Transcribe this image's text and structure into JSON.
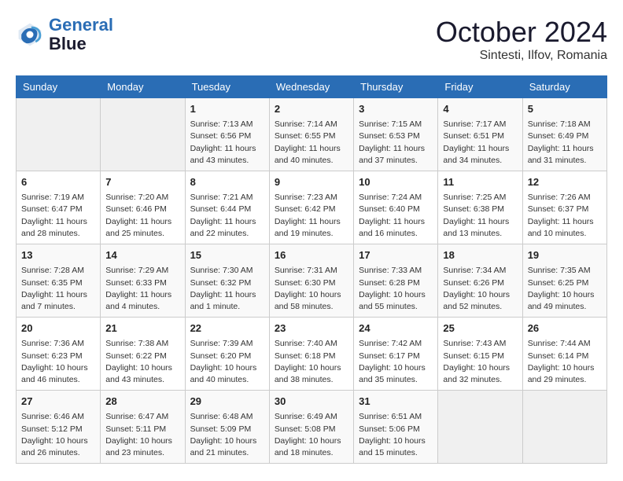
{
  "header": {
    "logo_line1": "General",
    "logo_line2": "Blue",
    "month": "October 2024",
    "location": "Sintesti, Ilfov, Romania"
  },
  "weekdays": [
    "Sunday",
    "Monday",
    "Tuesday",
    "Wednesday",
    "Thursday",
    "Friday",
    "Saturday"
  ],
  "weeks": [
    [
      {
        "day": "",
        "info": ""
      },
      {
        "day": "",
        "info": ""
      },
      {
        "day": "1",
        "info": "Sunrise: 7:13 AM\nSunset: 6:56 PM\nDaylight: 11 hours and 43 minutes."
      },
      {
        "day": "2",
        "info": "Sunrise: 7:14 AM\nSunset: 6:55 PM\nDaylight: 11 hours and 40 minutes."
      },
      {
        "day": "3",
        "info": "Sunrise: 7:15 AM\nSunset: 6:53 PM\nDaylight: 11 hours and 37 minutes."
      },
      {
        "day": "4",
        "info": "Sunrise: 7:17 AM\nSunset: 6:51 PM\nDaylight: 11 hours and 34 minutes."
      },
      {
        "day": "5",
        "info": "Sunrise: 7:18 AM\nSunset: 6:49 PM\nDaylight: 11 hours and 31 minutes."
      }
    ],
    [
      {
        "day": "6",
        "info": "Sunrise: 7:19 AM\nSunset: 6:47 PM\nDaylight: 11 hours and 28 minutes."
      },
      {
        "day": "7",
        "info": "Sunrise: 7:20 AM\nSunset: 6:46 PM\nDaylight: 11 hours and 25 minutes."
      },
      {
        "day": "8",
        "info": "Sunrise: 7:21 AM\nSunset: 6:44 PM\nDaylight: 11 hours and 22 minutes."
      },
      {
        "day": "9",
        "info": "Sunrise: 7:23 AM\nSunset: 6:42 PM\nDaylight: 11 hours and 19 minutes."
      },
      {
        "day": "10",
        "info": "Sunrise: 7:24 AM\nSunset: 6:40 PM\nDaylight: 11 hours and 16 minutes."
      },
      {
        "day": "11",
        "info": "Sunrise: 7:25 AM\nSunset: 6:38 PM\nDaylight: 11 hours and 13 minutes."
      },
      {
        "day": "12",
        "info": "Sunrise: 7:26 AM\nSunset: 6:37 PM\nDaylight: 11 hours and 10 minutes."
      }
    ],
    [
      {
        "day": "13",
        "info": "Sunrise: 7:28 AM\nSunset: 6:35 PM\nDaylight: 11 hours and 7 minutes."
      },
      {
        "day": "14",
        "info": "Sunrise: 7:29 AM\nSunset: 6:33 PM\nDaylight: 11 hours and 4 minutes."
      },
      {
        "day": "15",
        "info": "Sunrise: 7:30 AM\nSunset: 6:32 PM\nDaylight: 11 hours and 1 minute."
      },
      {
        "day": "16",
        "info": "Sunrise: 7:31 AM\nSunset: 6:30 PM\nDaylight: 10 hours and 58 minutes."
      },
      {
        "day": "17",
        "info": "Sunrise: 7:33 AM\nSunset: 6:28 PM\nDaylight: 10 hours and 55 minutes."
      },
      {
        "day": "18",
        "info": "Sunrise: 7:34 AM\nSunset: 6:26 PM\nDaylight: 10 hours and 52 minutes."
      },
      {
        "day": "19",
        "info": "Sunrise: 7:35 AM\nSunset: 6:25 PM\nDaylight: 10 hours and 49 minutes."
      }
    ],
    [
      {
        "day": "20",
        "info": "Sunrise: 7:36 AM\nSunset: 6:23 PM\nDaylight: 10 hours and 46 minutes."
      },
      {
        "day": "21",
        "info": "Sunrise: 7:38 AM\nSunset: 6:22 PM\nDaylight: 10 hours and 43 minutes."
      },
      {
        "day": "22",
        "info": "Sunrise: 7:39 AM\nSunset: 6:20 PM\nDaylight: 10 hours and 40 minutes."
      },
      {
        "day": "23",
        "info": "Sunrise: 7:40 AM\nSunset: 6:18 PM\nDaylight: 10 hours and 38 minutes."
      },
      {
        "day": "24",
        "info": "Sunrise: 7:42 AM\nSunset: 6:17 PM\nDaylight: 10 hours and 35 minutes."
      },
      {
        "day": "25",
        "info": "Sunrise: 7:43 AM\nSunset: 6:15 PM\nDaylight: 10 hours and 32 minutes."
      },
      {
        "day": "26",
        "info": "Sunrise: 7:44 AM\nSunset: 6:14 PM\nDaylight: 10 hours and 29 minutes."
      }
    ],
    [
      {
        "day": "27",
        "info": "Sunrise: 6:46 AM\nSunset: 5:12 PM\nDaylight: 10 hours and 26 minutes."
      },
      {
        "day": "28",
        "info": "Sunrise: 6:47 AM\nSunset: 5:11 PM\nDaylight: 10 hours and 23 minutes."
      },
      {
        "day": "29",
        "info": "Sunrise: 6:48 AM\nSunset: 5:09 PM\nDaylight: 10 hours and 21 minutes."
      },
      {
        "day": "30",
        "info": "Sunrise: 6:49 AM\nSunset: 5:08 PM\nDaylight: 10 hours and 18 minutes."
      },
      {
        "day": "31",
        "info": "Sunrise: 6:51 AM\nSunset: 5:06 PM\nDaylight: 10 hours and 15 minutes."
      },
      {
        "day": "",
        "info": ""
      },
      {
        "day": "",
        "info": ""
      }
    ]
  ]
}
